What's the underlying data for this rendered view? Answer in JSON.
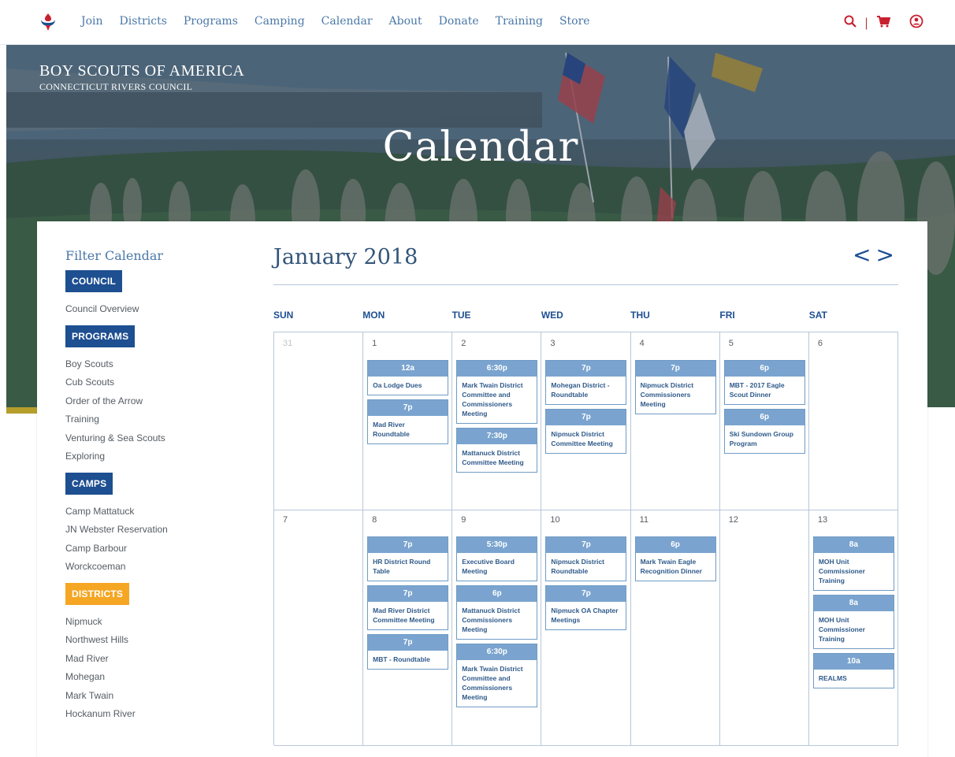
{
  "nav": {
    "links": [
      "Join",
      "Districts",
      "Programs",
      "Camping",
      "Calendar",
      "About",
      "Donate",
      "Training",
      "Store"
    ],
    "icons": [
      "search-icon",
      "cart-icon",
      "user-icon"
    ],
    "separator": "|"
  },
  "brand": {
    "line1": "BOY SCOUTS OF AMERICA",
    "line2": "CONNECTICUT RIVERS COUNCIL"
  },
  "hero": {
    "title": "Calendar"
  },
  "sidebar": {
    "title": "Filter Calendar",
    "groups": [
      {
        "label": "COUNCIL",
        "color": "#1d4f91",
        "items": [
          "Council Overview"
        ]
      },
      {
        "label": "PROGRAMS",
        "color": "#1d4f91",
        "items": [
          "Boy Scouts",
          "Cub Scouts",
          "Order of the Arrow",
          "Training",
          "Venturing & Sea Scouts",
          "Exploring"
        ]
      },
      {
        "label": "CAMPS",
        "color": "#1d4f91",
        "items": [
          "Camp Mattatuck",
          "JN Webster Reservation",
          "Camp Barbour",
          "Worckcoeman"
        ]
      },
      {
        "label": "DISTRICTS",
        "color": "#f5a623",
        "items": [
          "Nipmuck",
          "Northwest Hills",
          "Mad River",
          "Mohegan",
          "Mark Twain",
          "Hockanum River"
        ]
      }
    ]
  },
  "calendar": {
    "month": "January 2018",
    "prev": "<",
    "next": ">",
    "days_of_week": [
      "SUN",
      "MON",
      "TUE",
      "WED",
      "THU",
      "FRI",
      "SAT"
    ],
    "weeks": [
      [
        {
          "num": "31",
          "muted": true,
          "events": []
        },
        {
          "num": "1",
          "events": [
            {
              "time": "12a",
              "title": "Oa Lodge Dues"
            },
            {
              "time": "7p",
              "title": "Mad River Roundtable"
            }
          ]
        },
        {
          "num": "2",
          "events": [
            {
              "time": "6:30p",
              "title": "Mark Twain District Committee and Commissioners Meeting"
            },
            {
              "time": "7:30p",
              "title": "Mattanuck District Committee Meeting"
            }
          ]
        },
        {
          "num": "3",
          "events": [
            {
              "time": "7p",
              "title": "Mohegan District - Roundtable"
            },
            {
              "time": "7p",
              "title": "Nipmuck District Committee Meeting"
            }
          ]
        },
        {
          "num": "4",
          "events": [
            {
              "time": "7p",
              "title": "Nipmuck District Commissioners Meeting"
            }
          ]
        },
        {
          "num": "5",
          "events": [
            {
              "time": "6p",
              "title": "MBT - 2017 Eagle Scout Dinner"
            },
            {
              "time": "6p",
              "title": "Ski Sundown Group Program"
            }
          ]
        },
        {
          "num": "6",
          "events": []
        }
      ],
      [
        {
          "num": "7",
          "events": []
        },
        {
          "num": "8",
          "events": [
            {
              "time": "7p",
              "title": "HR District Round Table"
            },
            {
              "time": "7p",
              "title": "Mad River District Committee Meeting"
            },
            {
              "time": "7p",
              "title": "MBT - Roundtable"
            }
          ]
        },
        {
          "num": "9",
          "events": [
            {
              "time": "5:30p",
              "title": "Executive Board Meeting"
            },
            {
              "time": "6p",
              "title": "Mattanuck District Commissioners Meeting"
            },
            {
              "time": "6:30p",
              "title": "Mark Twain District Committee and Commissioners Meeting"
            }
          ]
        },
        {
          "num": "10",
          "events": [
            {
              "time": "7p",
              "title": "Nipmuck District Roundtable"
            },
            {
              "time": "7p",
              "title": "Nipmuck OA Chapter Meetings"
            }
          ]
        },
        {
          "num": "11",
          "events": [
            {
              "time": "6p",
              "title": "Mark Twain Eagle Recognition Dinner"
            }
          ]
        },
        {
          "num": "12",
          "events": []
        },
        {
          "num": "13",
          "events": [
            {
              "time": "8a",
              "title": "MOH Unit Commissioner Training"
            },
            {
              "time": "8a",
              "title": "MOH Unit Commissioner Training"
            },
            {
              "time": "10a",
              "title": "REALMS"
            }
          ]
        }
      ]
    ]
  }
}
